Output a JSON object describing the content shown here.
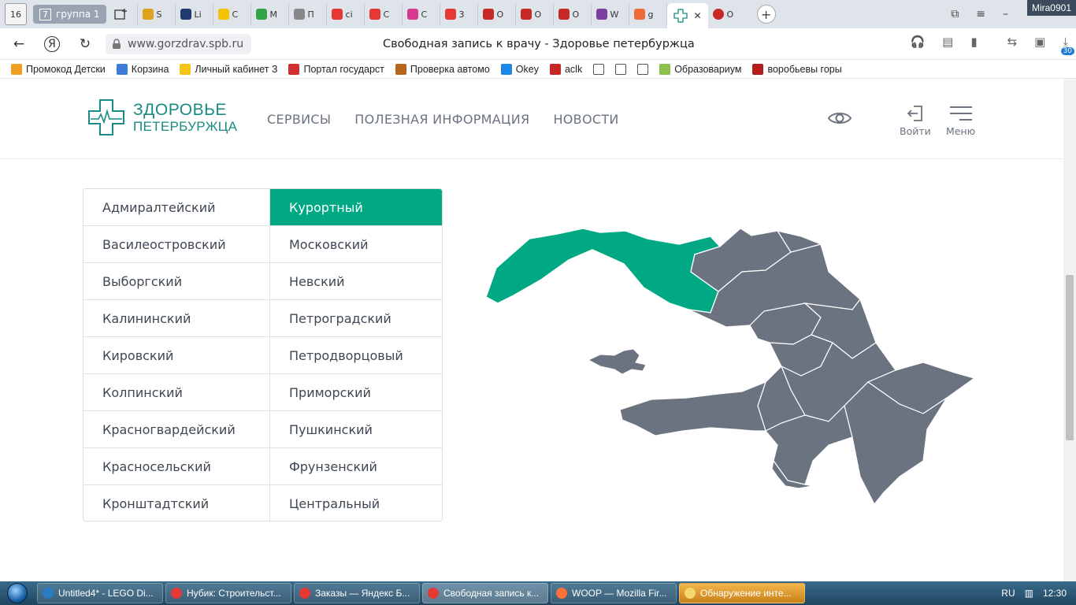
{
  "browser": {
    "tab_count": "16",
    "tab_group": {
      "count": "7",
      "label": "группа 1"
    },
    "mini_tabs": [
      {
        "label": "S",
        "color": "#e0a21c"
      },
      {
        "label": "Li",
        "color": "#1e3a6e"
      },
      {
        "label": "C",
        "color": "#f4c400"
      },
      {
        "label": "M",
        "color": "#33a34a"
      },
      {
        "label": "П",
        "color": "#888888"
      },
      {
        "label": "ci",
        "color": "#e53935"
      },
      {
        "label": "C",
        "color": "#e53935"
      },
      {
        "label": "C",
        "color": "#d8398f"
      },
      {
        "label": "3",
        "color": "#e53935"
      },
      {
        "label": "O",
        "color": "#c62828"
      },
      {
        "label": "O",
        "color": "#c62828"
      },
      {
        "label": "O",
        "color": "#c62828"
      },
      {
        "label": "W",
        "color": "#7b3fa0"
      },
      {
        "label": "g",
        "color": "#ef6c3a"
      }
    ],
    "active_tab_close": "✕",
    "last_tab": {
      "label": "O",
      "color": "#c62828"
    },
    "user_name": "Mira0901",
    "url": "www.gorzdrav.spb.ru",
    "page_title": "Свободная запись к врачу - Здоровье петербуржца",
    "downloads_count": "30"
  },
  "bookmarks": [
    {
      "label": "Промокод Детски",
      "color": "#f0a020"
    },
    {
      "label": "Корзина",
      "color": "#3b7dd8"
    },
    {
      "label": "Личный кабинет З",
      "color": "#f5c518"
    },
    {
      "label": "Портал государст",
      "color": "#d32f2f"
    },
    {
      "label": "Проверка автомо",
      "color": "#b5651d"
    },
    {
      "label": "Okey",
      "color": "#1e88e5"
    },
    {
      "label": "aclk",
      "color": "#c62828"
    },
    {
      "label": "",
      "color": "#ffffff"
    },
    {
      "label": "",
      "color": "#ffffff"
    },
    {
      "label": "",
      "color": "#ffffff"
    },
    {
      "label": "Образовариум",
      "color": "#8bc34a"
    },
    {
      "label": "воробьевы горы",
      "color": "#b71c1c"
    }
  ],
  "site": {
    "logo_line1": "ЗДОРОВЬЕ",
    "logo_line2": "ПЕТЕРБУРЖЦА",
    "nav": [
      "СЕРВИСЫ",
      "ПОЛЕЗНАЯ ИНФОРМАЦИЯ",
      "НОВОСТИ"
    ],
    "login_label": "Войти",
    "menu_label": "Меню",
    "accent_color": "#00a984",
    "map_color": "#6b7280"
  },
  "districts": {
    "left": [
      "Адмиралтейский",
      "Василеостровский",
      "Выборгский",
      "Калининский",
      "Кировский",
      "Колпинский",
      "Красногвардейский",
      "Красносельский",
      "Кронштадтский"
    ],
    "right": [
      "Курортный",
      "Московский",
      "Невский",
      "Петроградский",
      "Петродворцовый",
      "Приморский",
      "Пушкинский",
      "Фрунзенский",
      "Центральный"
    ],
    "selected": "Курортный"
  },
  "taskbar": {
    "items": [
      {
        "label": "Untitled4* - LEGO Di...",
        "color": "#2a7bc4"
      },
      {
        "label": "Нубик: Строительст...",
        "color": "#e53935"
      },
      {
        "label": "Заказы — Яндекс Б...",
        "color": "#e53935"
      },
      {
        "label": "Свободная запись к...",
        "color": "#e53935"
      },
      {
        "label": "WOOP — Mozilla Fir...",
        "color": "#ff7139"
      },
      {
        "label": "Обнаружение инте...",
        "color": "#f5d76e"
      }
    ],
    "active_index": 3,
    "lang": "RU",
    "time": "12:30"
  }
}
